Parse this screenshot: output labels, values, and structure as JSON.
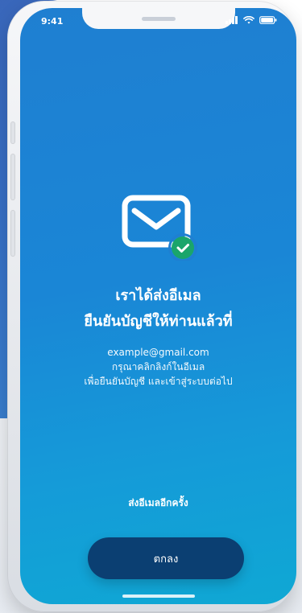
{
  "status_bar": {
    "time": "9:41",
    "icons": [
      "signal-icon",
      "wifi-icon",
      "battery-icon"
    ]
  },
  "screen": {
    "icon": "mail-check-icon",
    "title_line_1": "เราได้ส่งอีเมล",
    "title_line_2": "ยืนยันบัญชีให้ท่านแล้วที่",
    "message_line_1": "example@gmail.com",
    "message_line_2": "กรุณาคลิกลิงก์ในอีเมล",
    "message_line_3": "เพื่อยืนยันบัญชี และเข้าสู่ระบบต่อไป",
    "resend_label": "ส่งอีเมลอีกครั้ง",
    "ok_label": "ตกลง"
  },
  "colors": {
    "screen_gradient_top": "#1f7fd1",
    "screen_gradient_bottom": "#0fa8d4",
    "button_bg": "#0b3f72",
    "check_badge": "#1aa56b"
  }
}
